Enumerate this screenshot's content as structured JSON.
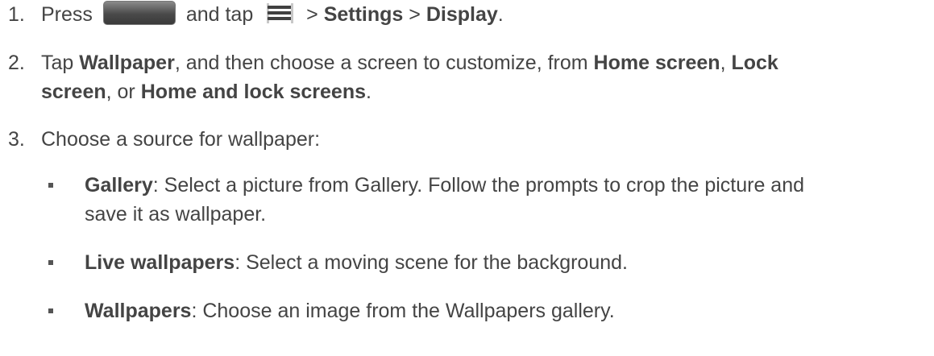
{
  "steps": [
    {
      "num": "1.",
      "press": "Press",
      "and_tap": "and tap",
      "sep1": ">",
      "settings": "Settings",
      "sep2": ">",
      "display": "Display",
      "end": "."
    },
    {
      "num": "2.",
      "t1": "Tap",
      "wallpaper": "Wallpaper",
      "t2": ", and then choose a screen to customize, from",
      "home_screen": "Home screen",
      "comma": ",",
      "lock": "Lock",
      "screen": "screen",
      "t3": ", or",
      "home_and_lock": "Home and lock screens",
      "end": "."
    },
    {
      "num": "3.",
      "text": "Choose a source for wallpaper:"
    }
  ],
  "options": [
    {
      "label": "Gallery",
      "line1": ": Select a picture from Gallery. Follow the prompts to crop the picture and",
      "line2": "save it as wallpaper."
    },
    {
      "label": "Live wallpapers",
      "line1": ": Select a moving scene for the background."
    },
    {
      "label": "Wallpapers",
      "line1": ": Choose an image from the Wallpapers gallery."
    }
  ],
  "icons": {
    "home_key": "home-key-icon",
    "menu": "menu-icon"
  }
}
